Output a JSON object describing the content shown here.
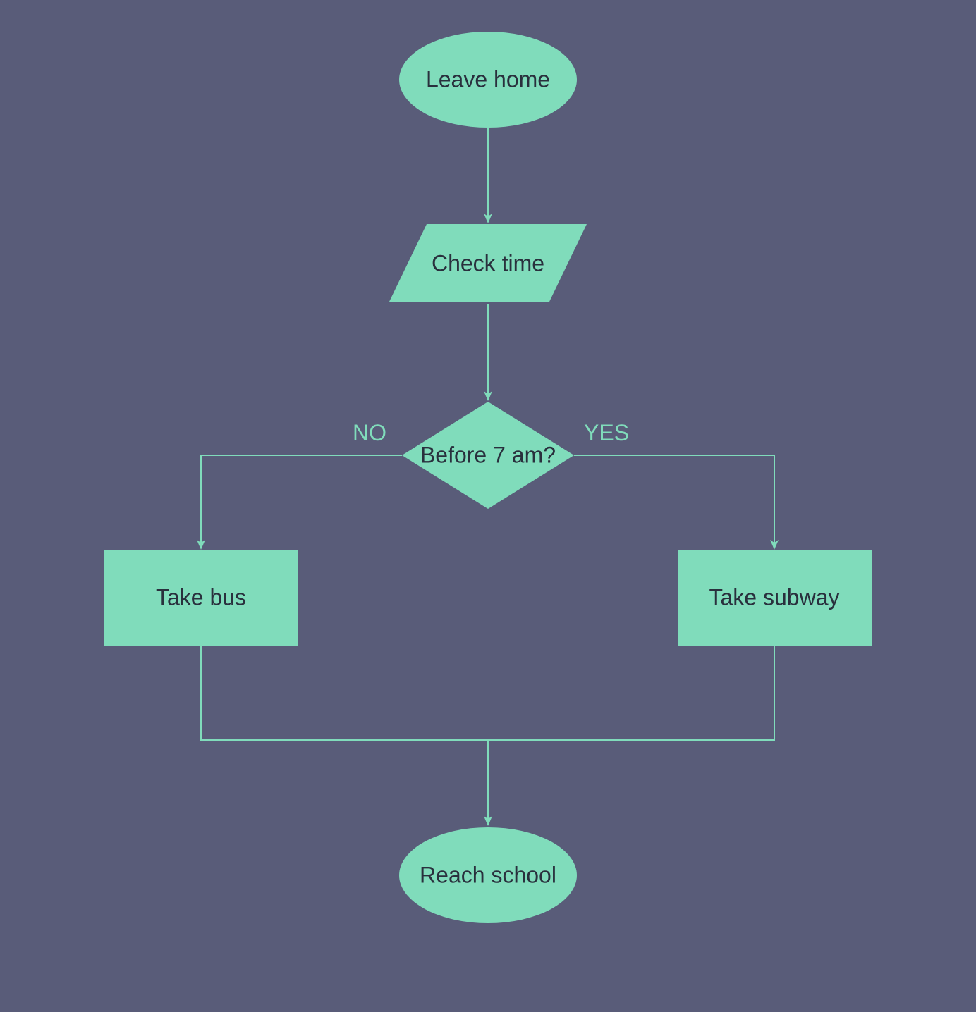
{
  "flowchart": {
    "nodes": {
      "start": {
        "label": "Leave home",
        "shape": "ellipse"
      },
      "check_time": {
        "label": "Check time",
        "shape": "parallelogram"
      },
      "decision": {
        "label": "Before 7 am?",
        "shape": "diamond"
      },
      "take_bus": {
        "label": "Take bus",
        "shape": "rectangle"
      },
      "take_subway": {
        "label": "Take subway",
        "shape": "rectangle"
      },
      "end": {
        "label": "Reach school",
        "shape": "ellipse"
      }
    },
    "edges": {
      "no_label": "NO",
      "yes_label": "YES"
    },
    "colors": {
      "bg": "#595c79",
      "shape_fill": "#80dcbb",
      "shape_text": "#29303d",
      "edge_stroke": "#80dcbb"
    }
  }
}
